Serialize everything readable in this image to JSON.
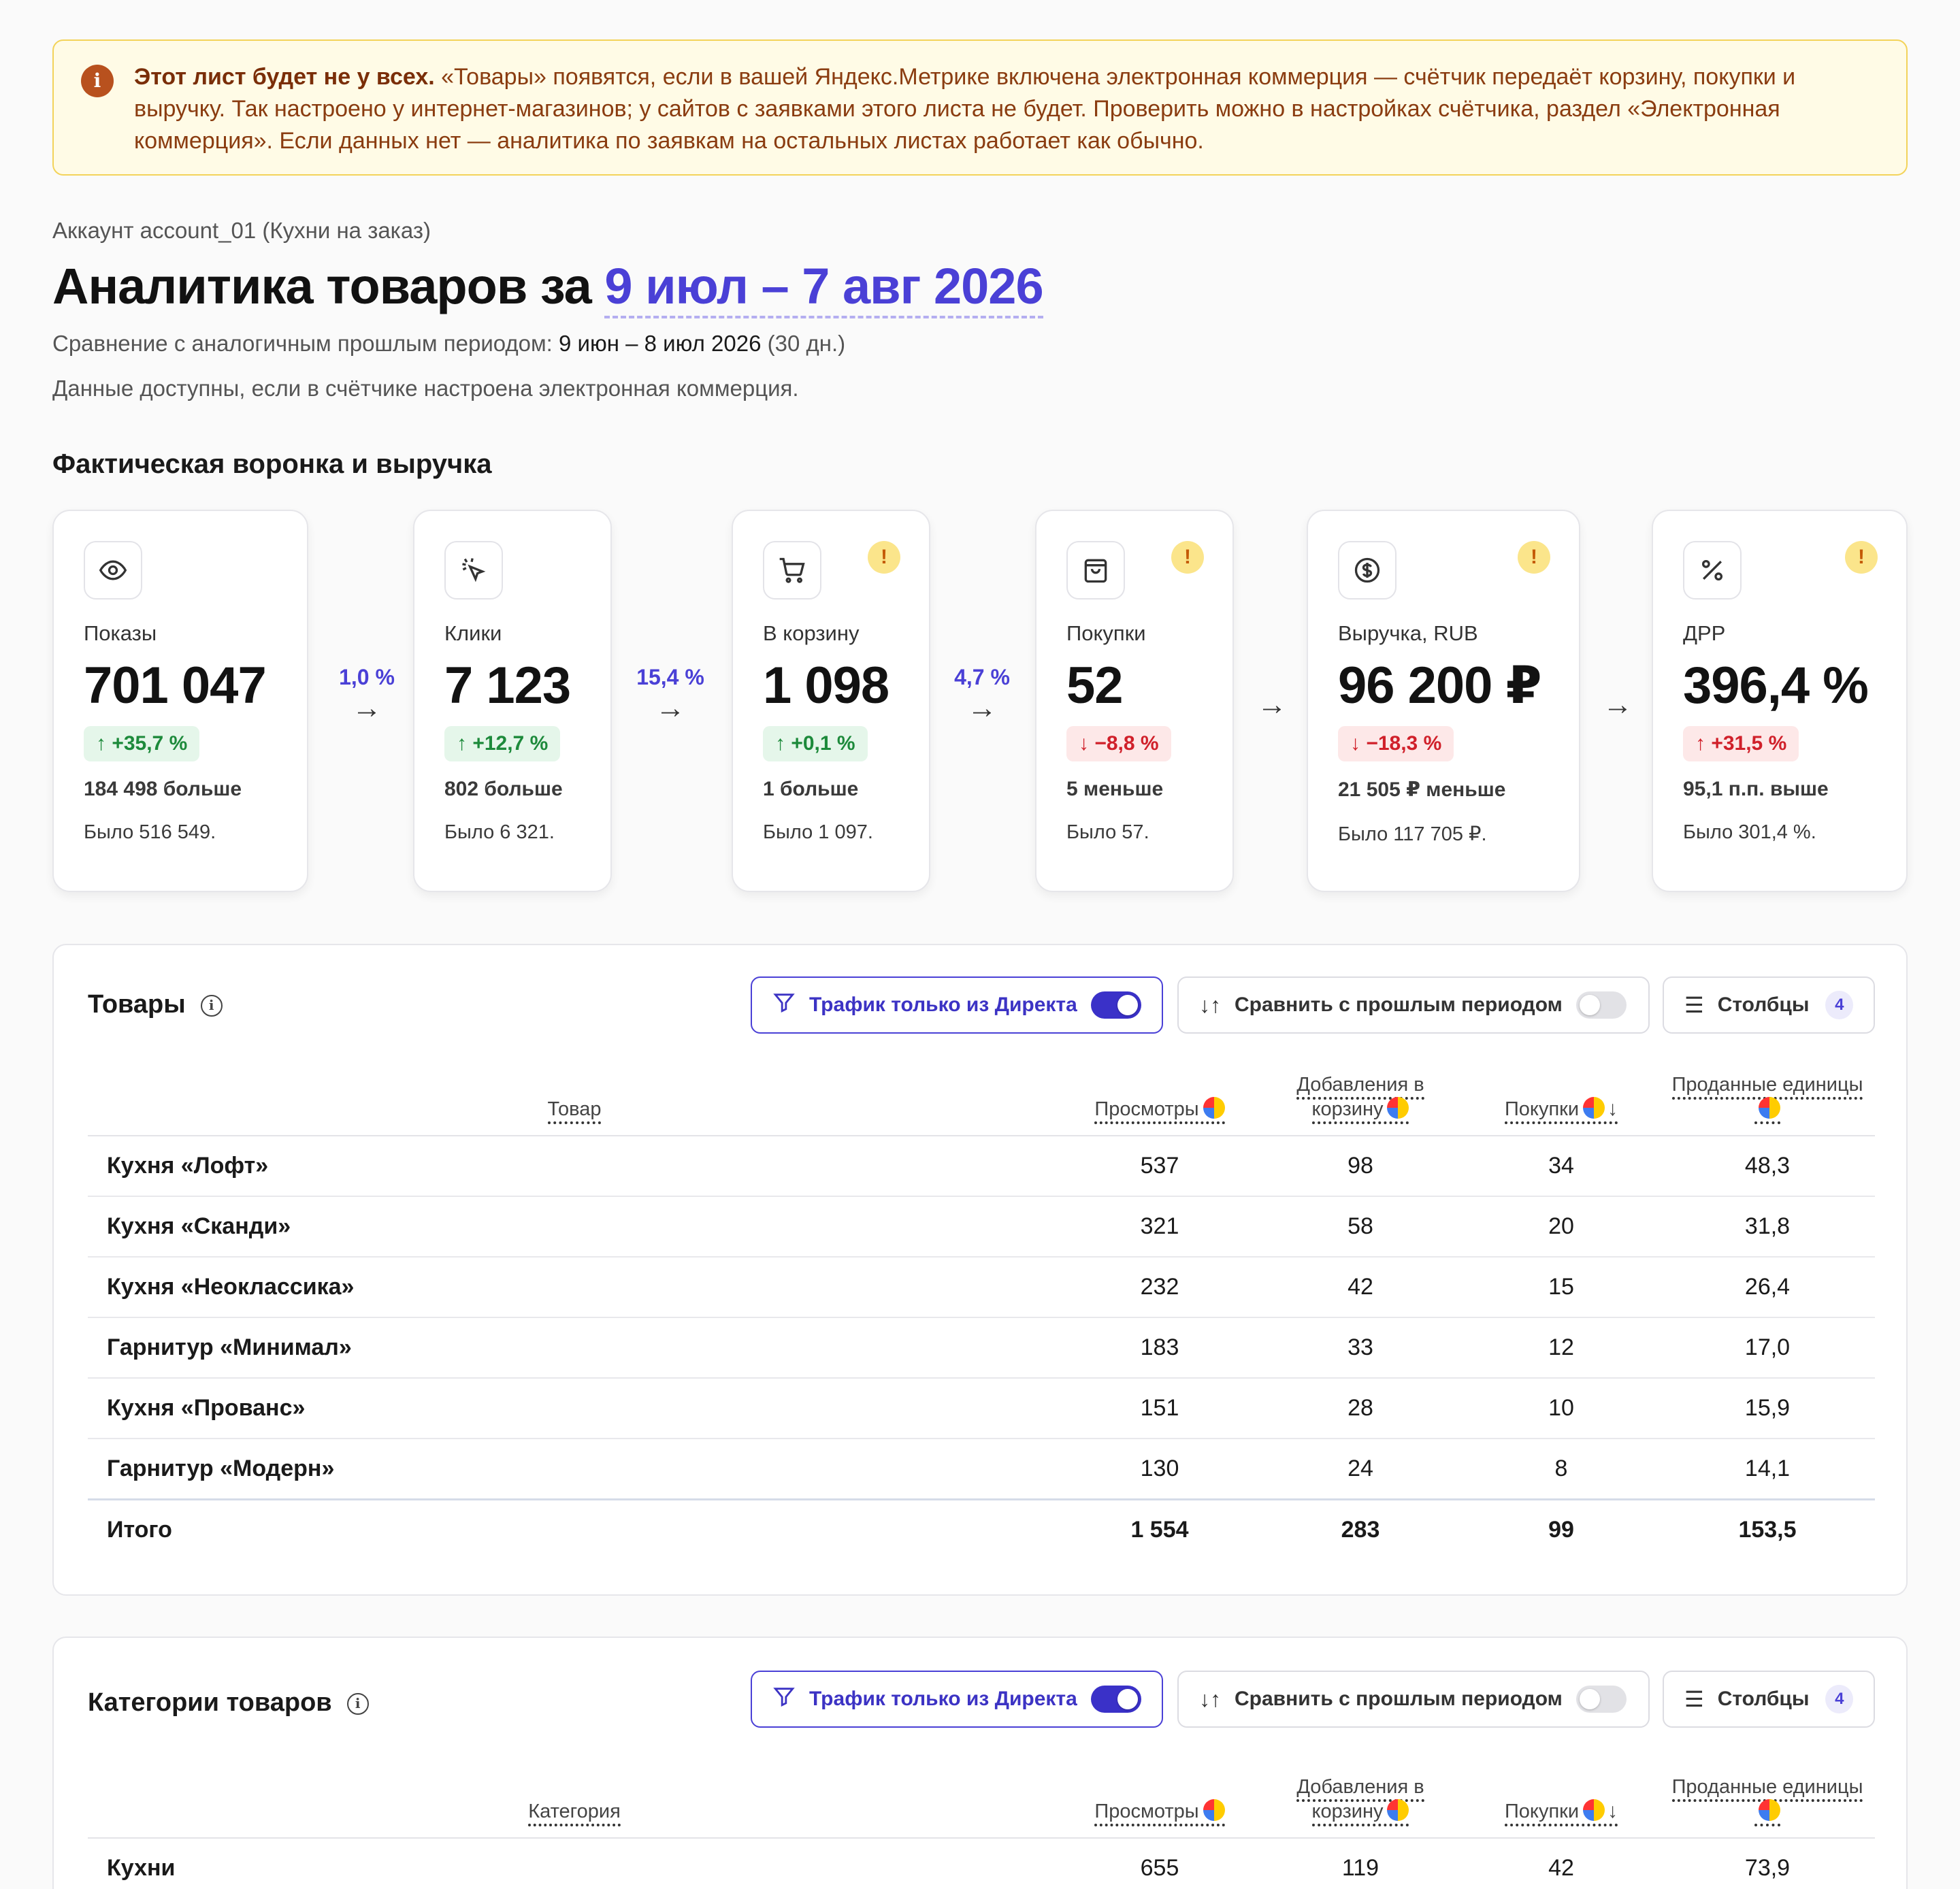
{
  "notice": {
    "bold": "Этот лист будет не у всех.",
    "text": " «Товары» появятся, если в вашей Яндекс.Метрике включена электронная коммерция — счётчик передаёт корзину, покупки и выручку. Так настроено у интернет-магазинов; у сайтов с заявками этого листа не будет. Проверить можно в настройках счётчика, раздел «Электронная коммерция». Если данных нет — аналитика по заявкам на остальных листах работает как обычно.",
    "icon": "info-icon"
  },
  "header": {
    "account": "Аккаунт account_01 (Кухни на заказ)",
    "title_prefix": "Аналитика товаров за ",
    "period": "9 июл – 7 авг 2026",
    "compare_label": "Сравнение с аналогичным прошлым периодом: ",
    "compare_period": "9 июн – 8 июл 2026",
    "compare_days": " (30 дн.)",
    "availability": "Данные доступны, если в счётчике настроена электронная коммерция."
  },
  "funnel": {
    "title": "Фактическая воронка и выручка",
    "cards": [
      {
        "icon": "eye-icon",
        "label": "Показы",
        "value": "701 047",
        "delta": "↑ +35,7 %",
        "diff": "184 498 больше",
        "was": "Было 516 549."
      },
      {
        "icon": "cursor-click-icon",
        "label": "Клики",
        "value": "7 123",
        "delta": "↑ +12,7 %",
        "diff": "802 больше",
        "was": "Было 6 321."
      },
      {
        "icon": "cart-icon",
        "label": "В корзину",
        "value": "1 098",
        "delta": "↑ +0,1 %",
        "diff": "1 больше",
        "was": "Было 1 097.",
        "warn": "!"
      },
      {
        "icon": "bag-icon",
        "label": "Покупки",
        "value": "52",
        "delta": "↓ −8,8 %",
        "diff": "5 меньше",
        "was": "Было 57.",
        "warn": "!"
      },
      {
        "icon": "dollar-icon",
        "label": "Выручка, RUB",
        "value": "96 200 ₽",
        "delta": "↓ −18,3 %",
        "diff": "21 505 ₽ меньше",
        "was": "Было 117 705 ₽.",
        "warn": "!"
      },
      {
        "icon": "percent-icon",
        "label": "ДРР",
        "value": "396,4 %",
        "delta": "↑ +31,5 %",
        "diff": "95,1 п.п. выше",
        "was": "Было 301,4 %.",
        "warn": "!"
      }
    ],
    "conversions": [
      "1,0 %",
      "15,4 %",
      "4,7 %"
    ],
    "arrow": "→"
  },
  "products": {
    "title": "Товары",
    "filter_label": "Трафик только из Директа",
    "compare_label": "Сравнить с прошлым периодом",
    "columns_label": "Столбцы",
    "columns_count": "4",
    "headers": {
      "name": "Товар",
      "views": "Просмотры",
      "cart": "Добавления в корзину",
      "purchases": "Покупки",
      "units": "Проданные единицы"
    },
    "rows": [
      {
        "name": "Кухня «Лофт»",
        "views": "537",
        "cart": "98",
        "purchases": "34",
        "units": "48,3"
      },
      {
        "name": "Кухня «Сканди»",
        "views": "321",
        "cart": "58",
        "purchases": "20",
        "units": "31,8"
      },
      {
        "name": "Кухня «Неоклассика»",
        "views": "232",
        "cart": "42",
        "purchases": "15",
        "units": "26,4"
      },
      {
        "name": "Гарнитур «Минимал»",
        "views": "183",
        "cart": "33",
        "purchases": "12",
        "units": "17,0"
      },
      {
        "name": "Кухня «Прованс»",
        "views": "151",
        "cart": "28",
        "purchases": "10",
        "units": "15,9"
      },
      {
        "name": "Гарнитур «Модерн»",
        "views": "130",
        "cart": "24",
        "purchases": "8",
        "units": "14,1"
      }
    ],
    "total": {
      "name": "Итого",
      "views": "1 554",
      "cart": "283",
      "purchases": "99",
      "units": "153,5"
    }
  },
  "categories": {
    "title": "Категории товаров",
    "filter_label": "Трафик только из Директа",
    "compare_label": "Сравнить с прошлым периодом",
    "columns_label": "Столбцы",
    "columns_count": "4",
    "headers": {
      "name": "Категория",
      "views": "Просмотры",
      "cart": "Добавления в корзину",
      "purchases": "Покупки",
      "units": "Проданные единицы"
    },
    "rows": [
      {
        "name": "Кухни",
        "views": "655",
        "cart": "119",
        "purchases": "42",
        "units": "73,9"
      }
    ]
  },
  "colors": {
    "accent": "#4a40d6",
    "positive": "#1d8a3b",
    "negative": "#d0202a",
    "notice_bg": "#fffbe6"
  }
}
